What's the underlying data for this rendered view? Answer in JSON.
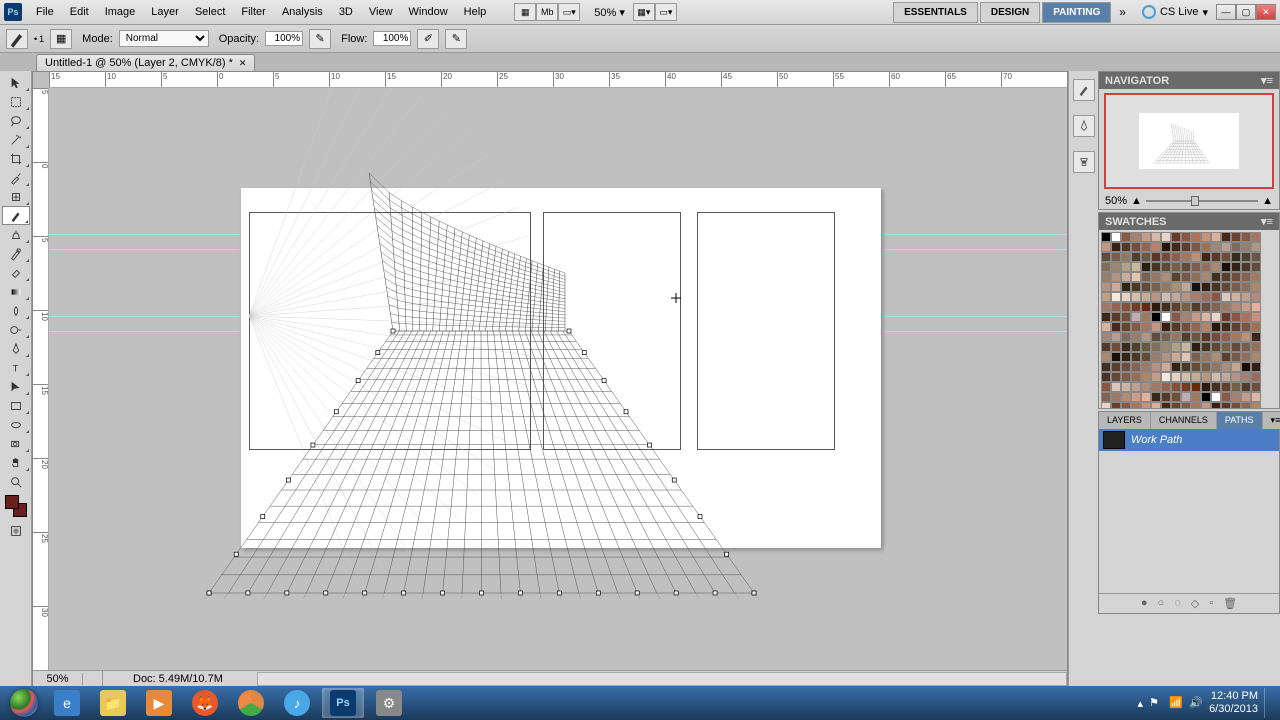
{
  "menubar": {
    "items": [
      "File",
      "Edit",
      "Image",
      "Layer",
      "Select",
      "Filter",
      "Analysis",
      "3D",
      "View",
      "Window",
      "Help"
    ],
    "zoom": "50%",
    "workspaces": [
      "ESSENTIALS",
      "DESIGN",
      "PAINTING"
    ],
    "cslive": "CS Live"
  },
  "options": {
    "brush_size": "1",
    "mode_label": "Mode:",
    "mode_value": "Normal",
    "opacity_label": "Opacity:",
    "opacity_value": "100%",
    "flow_label": "Flow:",
    "flow_value": "100%"
  },
  "doctab": {
    "title": "Untitled-1 @ 50% (Layer 2, CMYK/8) *"
  },
  "ruler_h": [
    "15",
    "10",
    "5",
    "0",
    "5",
    "10",
    "15",
    "20",
    "25",
    "30",
    "35",
    "40",
    "45",
    "50",
    "55",
    "60",
    "65",
    "70"
  ],
  "ruler_v": [
    "5",
    "0",
    "5",
    "10",
    "15",
    "20",
    "25",
    "30"
  ],
  "status": {
    "zoom": "50%",
    "docinfo": "Doc: 5.49M/10.7M"
  },
  "panels": {
    "navigator": {
      "title": "NAVIGATOR",
      "zoom": "50%"
    },
    "swatches": {
      "title": "SWATCHES"
    },
    "layers_tabs": [
      "LAYERS",
      "CHANNELS",
      "PATHS"
    ],
    "path_name": "Work Path"
  },
  "swatch_colors": [
    "#000",
    "#fff",
    "#8b5a44",
    "#a8826e",
    "#c49b86",
    "#d8b8a4",
    "#e8d4c8",
    "#6b3a2a",
    "#8a5642",
    "#aa7258",
    "#c89078",
    "#ddb098",
    "#4a2818",
    "#6a4430",
    "#885a44",
    "#a8765e",
    "#c69680",
    "#3b1f12",
    "#5a3624",
    "#784c38",
    "#96644e",
    "#b88268",
    "#2c160c",
    "#48281a",
    "#643e2c",
    "#82543e",
    "#a07054",
    "#9c8878",
    "#b4a090",
    "#7e6a5a",
    "#967e6e",
    "#ae9686",
    "#604c3c",
    "#786050",
    "#907864",
    "#52402e",
    "#6a5642",
    "#5a3828",
    "#724c3a",
    "#8a604c",
    "#a27860",
    "#ba9278",
    "#402414",
    "#583826",
    "#704c38",
    "#3a2a1a",
    "#52402e",
    "#6a5642",
    "#827056",
    "#9a886e",
    "#b2a086",
    "#cab89e",
    "#2c1e0e",
    "#443420",
    "#5c4a34",
    "#746048",
    "#644838",
    "#7c5c4a",
    "#94705c",
    "#ac8870",
    "#181008",
    "#302418",
    "#483828",
    "#604c38",
    "#9a7c6a",
    "#b29480",
    "#caac96",
    "#e2c4ae",
    "#7c5e4c",
    "#947662",
    "#ac8e78",
    "#5e402e",
    "#765844",
    "#8e705a",
    "#a68870",
    "#403020",
    "#583e2e",
    "#704c3c",
    "#88624e",
    "#a07a64",
    "#b8927e",
    "#d0aa98",
    "#322414",
    "#4a3828",
    "#624c38",
    "#7a604a",
    "#92785e",
    "#aa9076",
    "#c2a88e",
    "#1a0e04",
    "#322014",
    "#4a3424",
    "#624834",
    "#7a5c44",
    "#926e56",
    "#aa866c",
    "#c29e82",
    "#f2e8de",
    "#e4d2c4",
    "#d6beae",
    "#c8aa98",
    "#ba9682",
    "#d0bcae",
    "#c2a898",
    "#b49484",
    "#a6806e",
    "#986c58",
    "#8a5842",
    "#dac8ba",
    "#ccb4a4",
    "#bea090",
    "#b08c7a",
    "#a27864",
    "#94644e",
    "#865038",
    "#783c22",
    "#6a280c",
    "#2e1a0a",
    "#462e1c",
    "#5e422e",
    "#766040",
    "#543c2c",
    "#6c503e",
    "#846450",
    "#9c7862",
    "#b48c76",
    "#cc9e88",
    "#e4b09a",
    "#3c2816",
    "#543c28",
    "#6c503a",
    "#8464",
    "#9c7a5e"
  ],
  "taskbar": {
    "time": "12:40 PM",
    "date": "6/30/2013"
  }
}
